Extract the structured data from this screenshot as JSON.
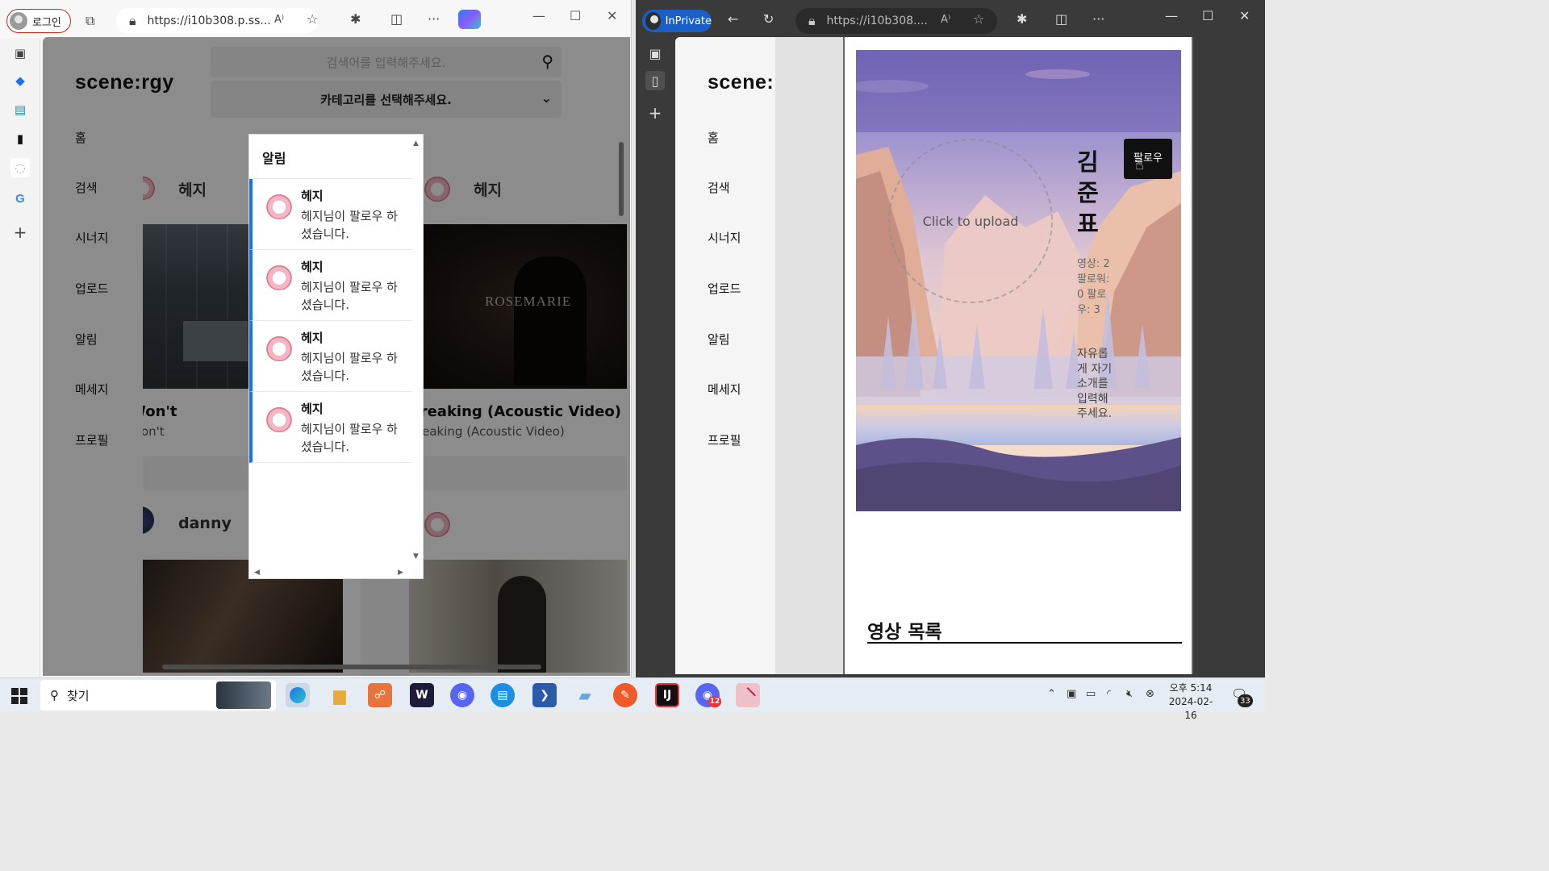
{
  "left_browser": {
    "login_label": "로그인",
    "url": "https://i10b308.p.ss...",
    "site": {
      "logo": "scene:rgy",
      "nav": [
        "홈",
        "검색",
        "시너지",
        "업로드",
        "알림",
        "메세지",
        "프로필"
      ],
      "search_placeholder": "검색어를 입력해주세요.",
      "category_placeholder": "카테고리를 선택해주세요.",
      "cards": [
        {
          "user": "헤지",
          "title": "Won't",
          "subtitle": "Won't"
        },
        {
          "user": "헤지",
          "title": "Breaking (Acoustic Video)",
          "subtitle": "Breaking (Acoustic Video)",
          "thumb_text": "ROSEMARIE"
        },
        {
          "user": "danny"
        },
        {
          "user": ""
        }
      ]
    },
    "notifications": {
      "title": "알림",
      "items": [
        {
          "name": "헤지",
          "message": "헤지님이 팔로우 하셨습니다."
        },
        {
          "name": "헤지",
          "message": "헤지님이 팔로우 하셨습니다."
        },
        {
          "name": "헤지",
          "message": "헤지님이 팔로우 하셨습니다."
        },
        {
          "name": "헤지",
          "message": "헤지님이 팔로우 하셨습니다."
        }
      ]
    }
  },
  "right_browser": {
    "inprivate_label": "InPrivate",
    "url": "https://i10b308....",
    "site": {
      "logo": "scene:rgy",
      "nav": [
        "홈",
        "검색",
        "시너지",
        "업로드",
        "알림",
        "메세지",
        "프로필"
      ],
      "profile": {
        "upload_prompt": "Click to upload",
        "name": "김준표",
        "stats": "영상: 2 팔로워: 0 팔로우: 3",
        "bio": "자유롭게 자기소개를 입력해주세요.",
        "follow_label": "팔로우"
      },
      "video_list_title": "영상 목록"
    }
  },
  "taskbar": {
    "search_label": "찾기",
    "time": "오후 5:14",
    "date": "2024-02-16",
    "notification_count": "33",
    "discord_badge": "12"
  },
  "colors": {
    "accent_blue": "#1a73e8",
    "inprivate_blue": "#1a5ec7",
    "login_border": "#c42b1c"
  }
}
